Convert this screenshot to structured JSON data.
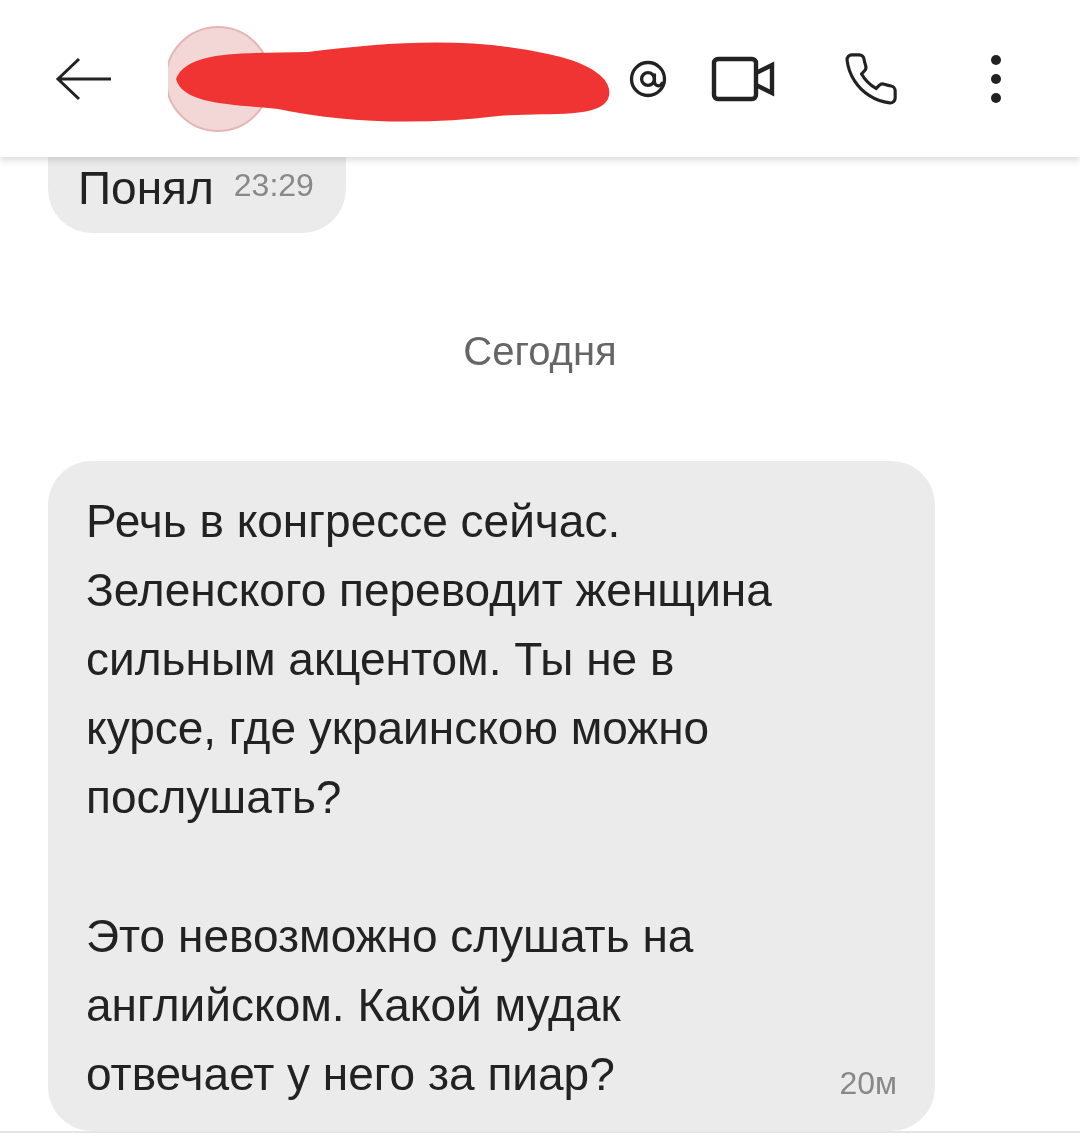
{
  "messages": [
    {
      "kind": "incoming",
      "paragraphs": [
        "Понял"
      ],
      "time": "23:29",
      "clipped": true
    },
    {
      "kind": "date",
      "text": "Сегодня"
    },
    {
      "kind": "incoming",
      "paragraphs": [
        "Речь в конгрессе сейчас. Зеленского переводит женщина сильным акцентом. Ты не в курсе, где украинскою можно послушать?",
        "Это невозможно слушать на английском. Какой мудак отвечает у него за пиар?"
      ],
      "time": "20м",
      "clipped": false
    }
  ]
}
